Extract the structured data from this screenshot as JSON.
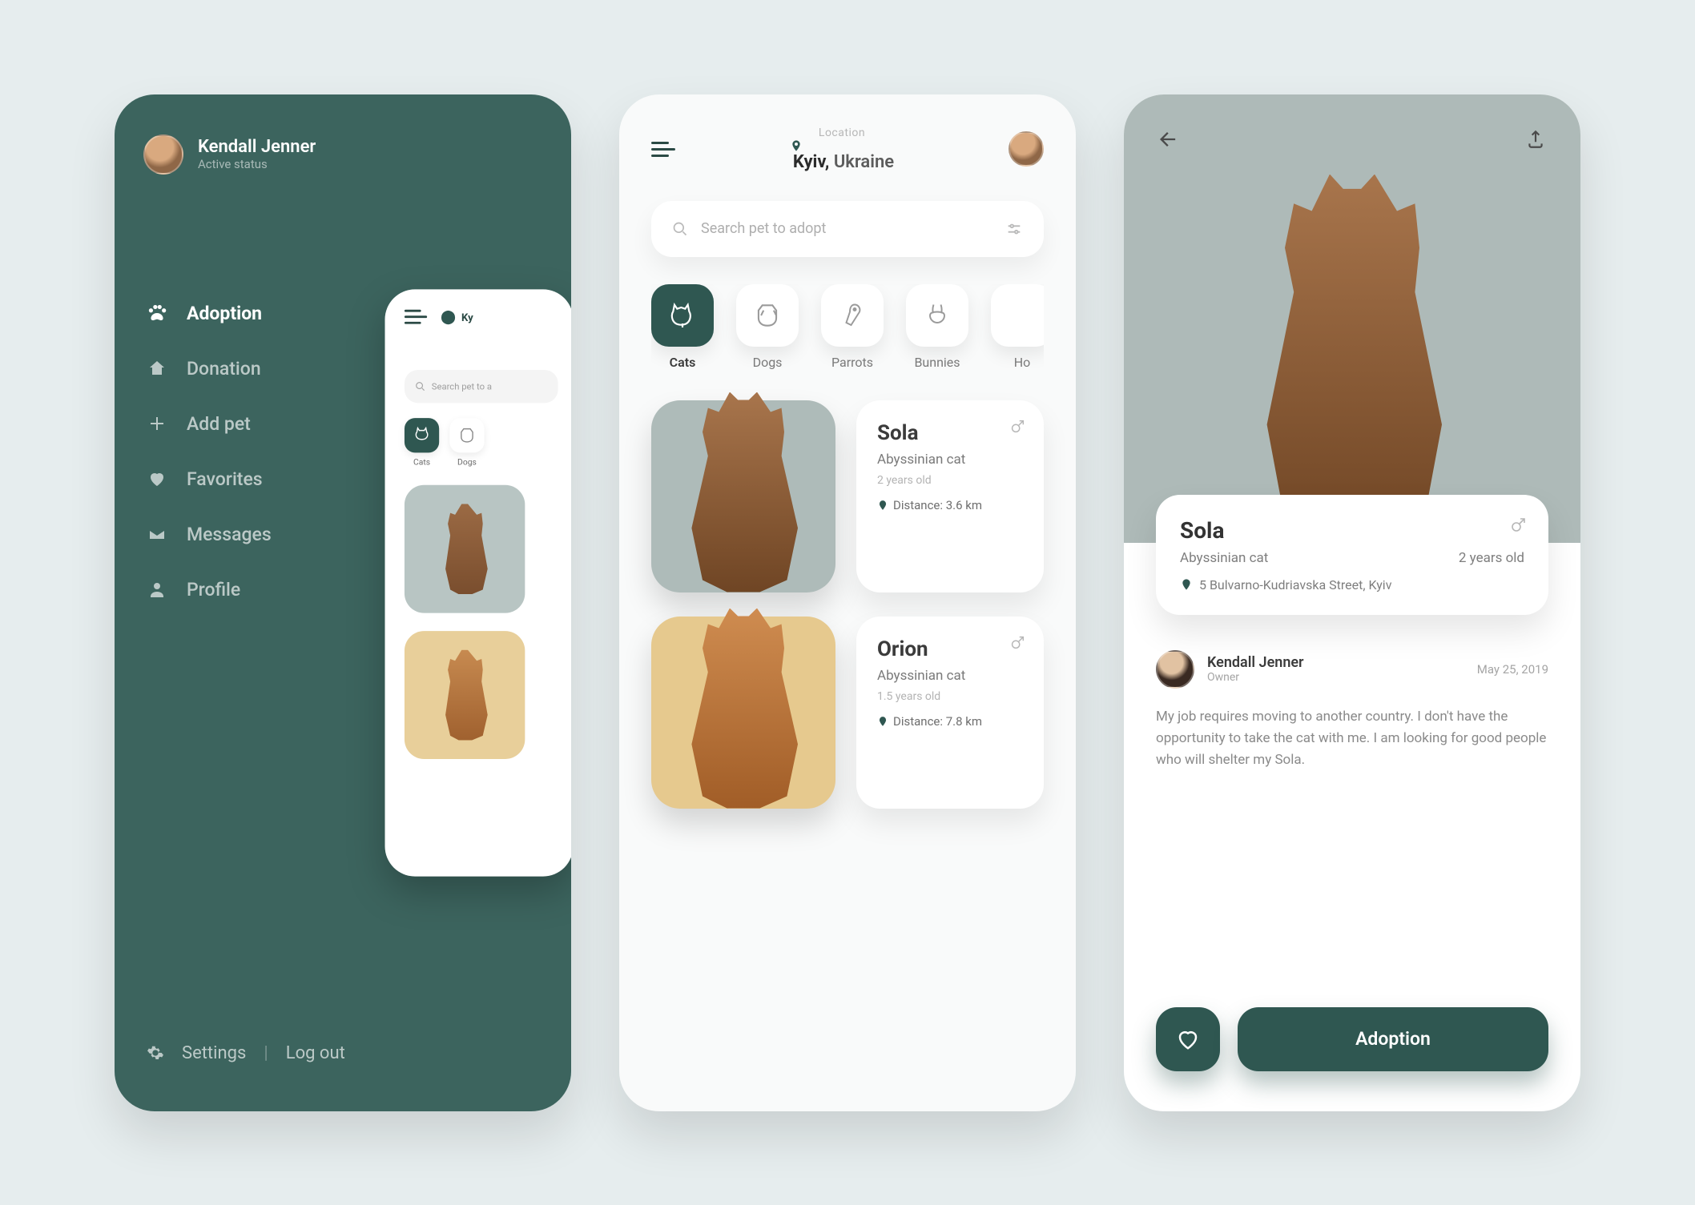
{
  "colors": {
    "accent": "#2f5751",
    "drawer_bg": "#3c645e"
  },
  "user": {
    "name": "Kendall Jenner",
    "status": "Active status"
  },
  "menu": {
    "items": [
      {
        "icon": "paw-icon",
        "label": "Adoption",
        "active": true
      },
      {
        "icon": "home-icon",
        "label": "Donation",
        "active": false
      },
      {
        "icon": "plus-icon",
        "label": "Add pet",
        "active": false
      },
      {
        "icon": "heart-icon",
        "label": "Favorites",
        "active": false
      },
      {
        "icon": "mail-icon",
        "label": "Messages",
        "active": false
      },
      {
        "icon": "person-icon",
        "label": "Profile",
        "active": false
      }
    ],
    "settings": "Settings",
    "logout": "Log out"
  },
  "mini": {
    "loc_prefix": "Ky",
    "search_placeholder": "Search pet to a",
    "cats_label": "Cats",
    "dogs_label": "Dogs"
  },
  "browse": {
    "location_label": "Location",
    "city": "Kyiv,",
    "country": "Ukraine",
    "search_placeholder": "Search pet to adopt",
    "categories": [
      {
        "label": "Cats",
        "active": true
      },
      {
        "label": "Dogs",
        "active": false
      },
      {
        "label": "Parrots",
        "active": false
      },
      {
        "label": "Bunnies",
        "active": false
      },
      {
        "label": "Ho",
        "active": false
      }
    ],
    "pets": [
      {
        "name": "Sola",
        "breed": "Abyssinian cat",
        "age": "2 years old",
        "distance": "Distance: 3.6 km",
        "tint": "grey"
      },
      {
        "name": "Orion",
        "breed": "Abyssinian cat",
        "age": "1.5 years old",
        "distance": "Distance: 7.8 km",
        "tint": "gold"
      }
    ]
  },
  "detail": {
    "name": "Sola",
    "breed": "Abyssinian cat",
    "age": "2 years old",
    "address": "5 Bulvarno-Kudriavska Street, Kyiv",
    "owner_name": "Kendall Jenner",
    "owner_role": "Owner",
    "date": "May 25, 2019",
    "description": "My job requires moving to another country. I don't have the opportunity to take the cat with me. I am looking for good people who will shelter my Sola.",
    "adopt_label": "Adoption"
  }
}
